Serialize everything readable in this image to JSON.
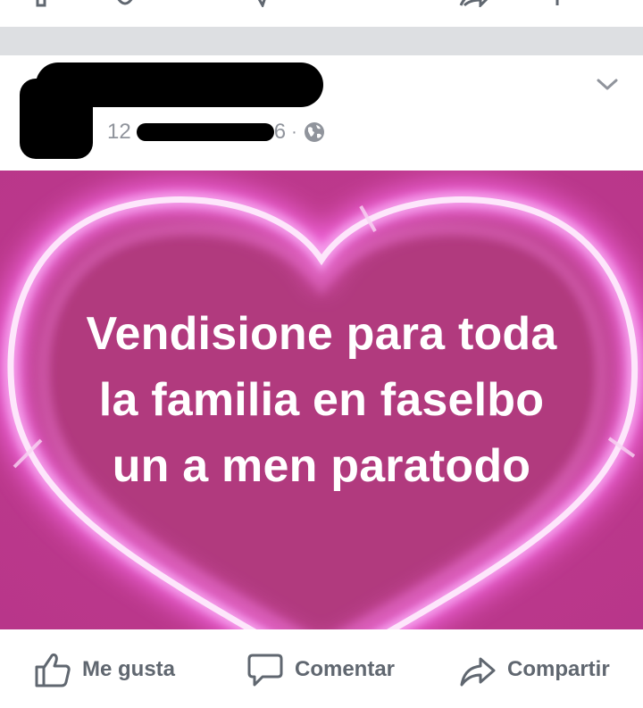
{
  "post": {
    "meta": {
      "time_fragment_start": "12",
      "time_fragment_end": "6",
      "separator": "·",
      "privacy_icon": "globe-icon"
    },
    "menu_icon": "chevron-down-icon",
    "image_text": [
      "Vendisione para toda",
      "la familia en faselbo",
      "un a men paratodo"
    ]
  },
  "actions": {
    "like_label": "Me gusta",
    "comment_label": "Comentar",
    "share_label": "Compartir"
  },
  "colors": {
    "separator": "#dddfe2",
    "meta_text": "#90949c",
    "action_text": "#606770",
    "image_background": "#c83a93",
    "heart_fill": "#b13a7e",
    "neon_glow": "#f3a8ec"
  }
}
